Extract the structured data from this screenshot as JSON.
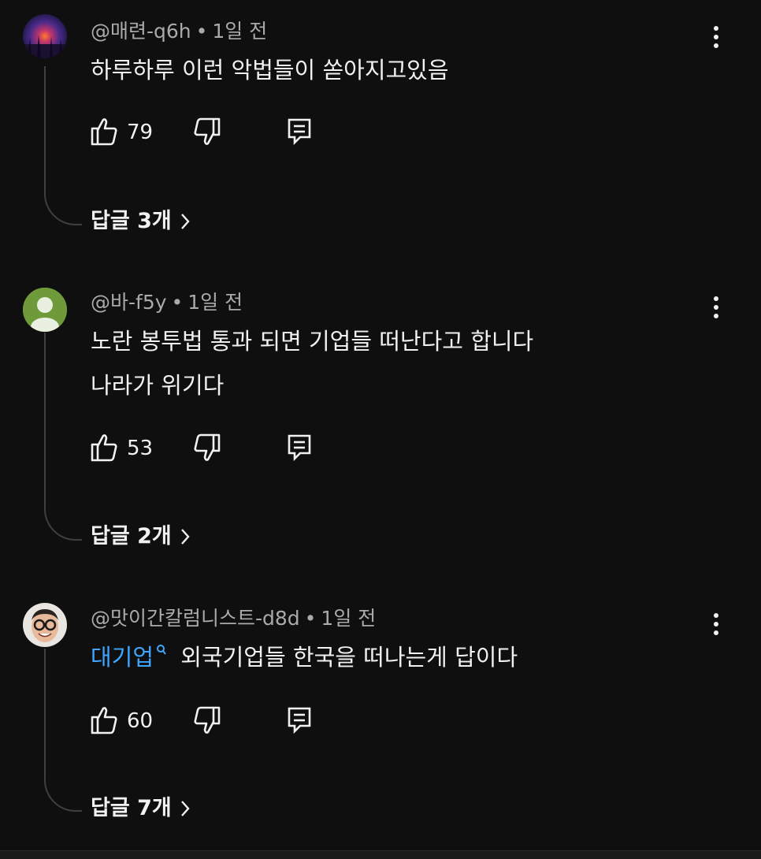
{
  "comments": [
    {
      "author": "@매련-q6h",
      "time": "1일 전",
      "lines": [
        "하루하루 이런 악법들이 쏟아지고있음"
      ],
      "likes": "79",
      "replies_label": "답글 3개"
    },
    {
      "author": "@바-f5y",
      "time": "1일 전",
      "lines": [
        "노란 봉투법 통과 되면 기업들 떠난다고 합니다",
        "나라가 위기다"
      ],
      "likes": "53",
      "replies_label": "답글 2개"
    },
    {
      "author": "@맛이간칼럼니스트-d8d",
      "time": "1일 전",
      "hashtag": "대기업",
      "lines": [
        "외국기업들 한국을 떠나는게 답이다"
      ],
      "likes": "60",
      "replies_label": "답글 7개"
    }
  ],
  "separator": "•",
  "icons": {
    "like": "thumbs-up-icon",
    "dislike": "thumbs-down-icon",
    "reply": "reply-comment-icon",
    "more": "more-vert-icon",
    "chevron": "chevron-right-icon",
    "hashtag": "search-icon"
  },
  "colors": {
    "background": "#0f0f0f",
    "text": "#f1f1f1",
    "secondary_text": "#aaaaaa",
    "link": "#3ea6ff"
  }
}
